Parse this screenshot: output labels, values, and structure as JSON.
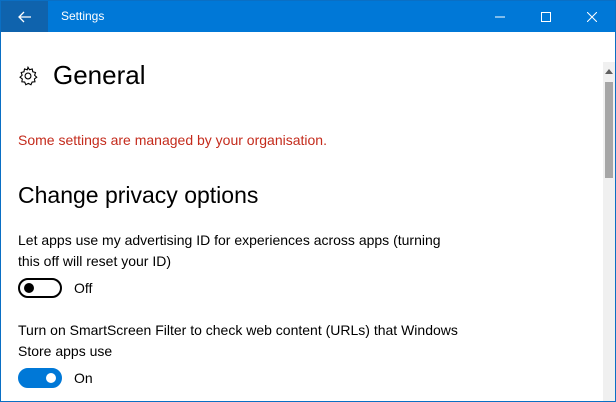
{
  "window": {
    "title": "Settings",
    "accent_color": "#0078d7",
    "controls": [
      "minimize-icon",
      "maximize-icon",
      "close-icon"
    ]
  },
  "header": {
    "icon": "gear-icon",
    "title": "General"
  },
  "notice": {
    "text": "Some settings are managed by your organisation.",
    "color": "#c42b1c"
  },
  "section": {
    "title": "Change privacy options"
  },
  "settings": [
    {
      "description": "Let apps use my advertising ID for experiences across apps (turning this off will reset your ID)",
      "state": "off",
      "state_label": "Off"
    },
    {
      "description": "Turn on SmartScreen Filter to check web content (URLs) that Windows Store apps use",
      "state": "on",
      "state_label": "On"
    }
  ]
}
